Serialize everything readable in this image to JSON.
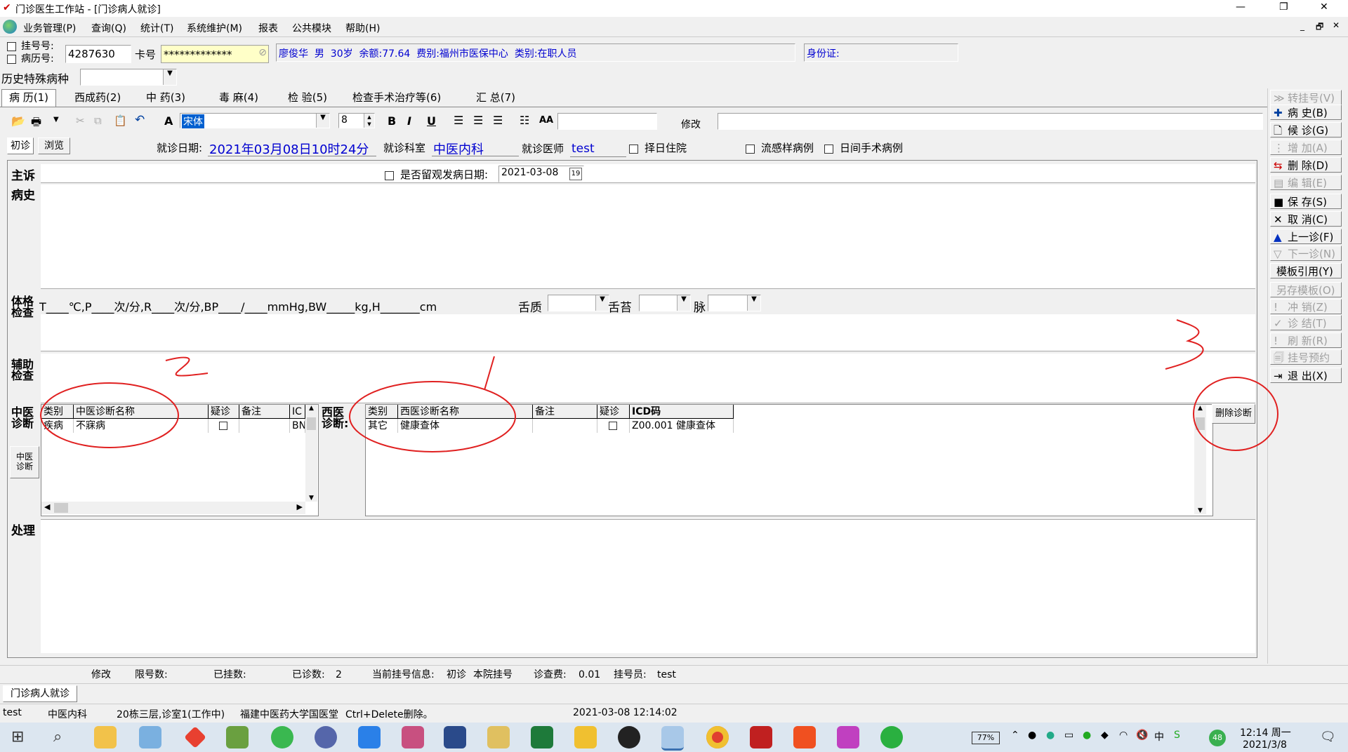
{
  "window": {
    "title": "门诊医生工作站 - [门诊病人就诊]",
    "controls": {
      "minimize": "—",
      "restore": "❐",
      "close": "✕"
    },
    "mdi_controls": [
      "_",
      "🗗",
      "✕"
    ]
  },
  "menu": [
    "业务管理(P)",
    "查询(Q)",
    "统计(T)",
    "系统维护(M)",
    "报表",
    "公共模块",
    "帮助(H)"
  ],
  "patient": {
    "reg_check_label": "挂号号:",
    "record_check_label": "病历号:",
    "reg_no": "4287630",
    "card_label": "卡号",
    "card_value": "*************",
    "info": "廖俊华  男  30岁  余额:77.64  费别:福州市医保中心  类别:在职人员",
    "id_label": "身份证:",
    "history_disease_label": "历史特殊病种",
    "history_disease_value": ""
  },
  "tabs": [
    "病 历(1)",
    "西成药(2)",
    "中 药(3)",
    "毒 麻(4)",
    "检 验(5)",
    "检查手术治疗等(6)",
    "汇 总(7)"
  ],
  "toolbar": {
    "font_name": "宋体",
    "font_size": "8",
    "bold": "B",
    "italic": "I",
    "underline": "U",
    "modify_label": "修改"
  },
  "visit": {
    "mode_tabs": [
      "初诊",
      "浏览"
    ],
    "date_label": "就诊日期:",
    "date_value": "2021年03月08日10时24分",
    "dept_label": "就诊科室",
    "dept_value": "中医内科",
    "doctor_label": "就诊医师",
    "doctor_value": "test",
    "chk_choose_day": "择日住院",
    "chk_flu": "流感样病例",
    "chk_day_surgery": "日间手术病例"
  },
  "record": {
    "complaint_label": "主诉",
    "observe_label": "是否留观发病日期:",
    "onset_date": "2021-03-08",
    "history_label": "病史",
    "physical_label_1": "体格",
    "physical_label_2": "检查",
    "vitals_line": "T____℃,P____次/分,R____次/分,BP____/____mmHg,BW_____kg,H_______cm",
    "tongue_label": "舌质",
    "coating_label": "舌苔",
    "pulse_label": "脉",
    "aux_label_1": "辅助",
    "aux_label_2": "检查",
    "tcm_label_1": "中医",
    "tcm_label_2": "诊断",
    "tcm_side_btn_1": "中医",
    "tcm_side_btn_2": "诊断",
    "west_label_1": "西医",
    "west_label_2": "诊断:",
    "treatment_label": "处理"
  },
  "tcm_diag": {
    "headers": [
      "类别",
      "中医诊断名称",
      "疑诊",
      "备注",
      "IC"
    ],
    "rows": [
      {
        "type": "疾病",
        "name": "不寐病",
        "note": "",
        "code": "BN"
      }
    ]
  },
  "west_diag": {
    "headers": [
      "类别",
      "西医诊断名称",
      "备注",
      "疑诊",
      "ICD码"
    ],
    "rows": [
      {
        "type": "其它",
        "name": "健康查体",
        "note": "",
        "icd": "Z00.001 健康查体"
      }
    ],
    "delete_btn": "删除诊断"
  },
  "right_buttons": [
    {
      "label": "转挂号(V)",
      "icon": "forward-icon",
      "enabled": false
    },
    {
      "label": "病  史(B)",
      "icon": "plus-icon",
      "enabled": true
    },
    {
      "label": "候  诊(G)",
      "icon": "document-icon",
      "enabled": true
    },
    {
      "label": "增  加(A)",
      "icon": "add-icon",
      "enabled": false
    },
    {
      "label": "删  除(D)",
      "icon": "delete-icon",
      "enabled": true
    },
    {
      "label": "编  辑(E)",
      "icon": "edit-icon",
      "enabled": false
    },
    {
      "label": "保  存(S)",
      "icon": "save-icon",
      "enabled": true
    },
    {
      "label": "取  消(C)",
      "icon": "cancel-icon",
      "enabled": true
    },
    {
      "label": "上一诊(F)",
      "icon": "up-icon",
      "enabled": true
    },
    {
      "label": "下一诊(N)",
      "icon": "down-icon",
      "enabled": false
    },
    {
      "label": "模板引用(Y)",
      "icon": "",
      "enabled": true
    },
    {
      "label": "另存模板(O)",
      "icon": "",
      "enabled": false
    },
    {
      "label": "冲  销(Z)",
      "icon": "reverse-icon",
      "enabled": false
    },
    {
      "label": "诊  结(T)",
      "icon": "conclude-icon",
      "enabled": false
    },
    {
      "label": "刷  新(R)",
      "icon": "refresh-icon",
      "enabled": false
    },
    {
      "label": "挂号预约",
      "icon": "calendar-icon",
      "enabled": false
    },
    {
      "label": "退  出(X)",
      "icon": "exit-icon",
      "enabled": true
    }
  ],
  "status_row": {
    "modify": "修改",
    "limit_label": "限号数:",
    "limit_value": "",
    "registered_label": "已挂数:",
    "registered_value": "",
    "seen_label": "已诊数:",
    "seen_value": "2",
    "current_label": "当前挂号信息:",
    "current_v1": "初诊",
    "current_v2": "本院挂号",
    "fee_label": "诊查费:",
    "fee_value": "0.01",
    "registrar_label": "挂号员:",
    "registrar_value": "test"
  },
  "window_tab": "门诊病人就诊",
  "statusbar": {
    "user": "test",
    "dept": "中医内科",
    "room": "20栋三层,诊室1(工作中)",
    "hospital": "福建中医药大学国医堂",
    "hint": "Ctrl+Delete删除。",
    "datetime": "2021-03-08 12:14:02"
  },
  "taskbar": {
    "battery": "77%",
    "time": "12:14 周一",
    "date": "2021/3/8",
    "notification_count": "48"
  },
  "colors": {
    "accent_blue": "#0000d0",
    "annotation_red": "#e02020",
    "taskbar": "#dce6f0"
  }
}
